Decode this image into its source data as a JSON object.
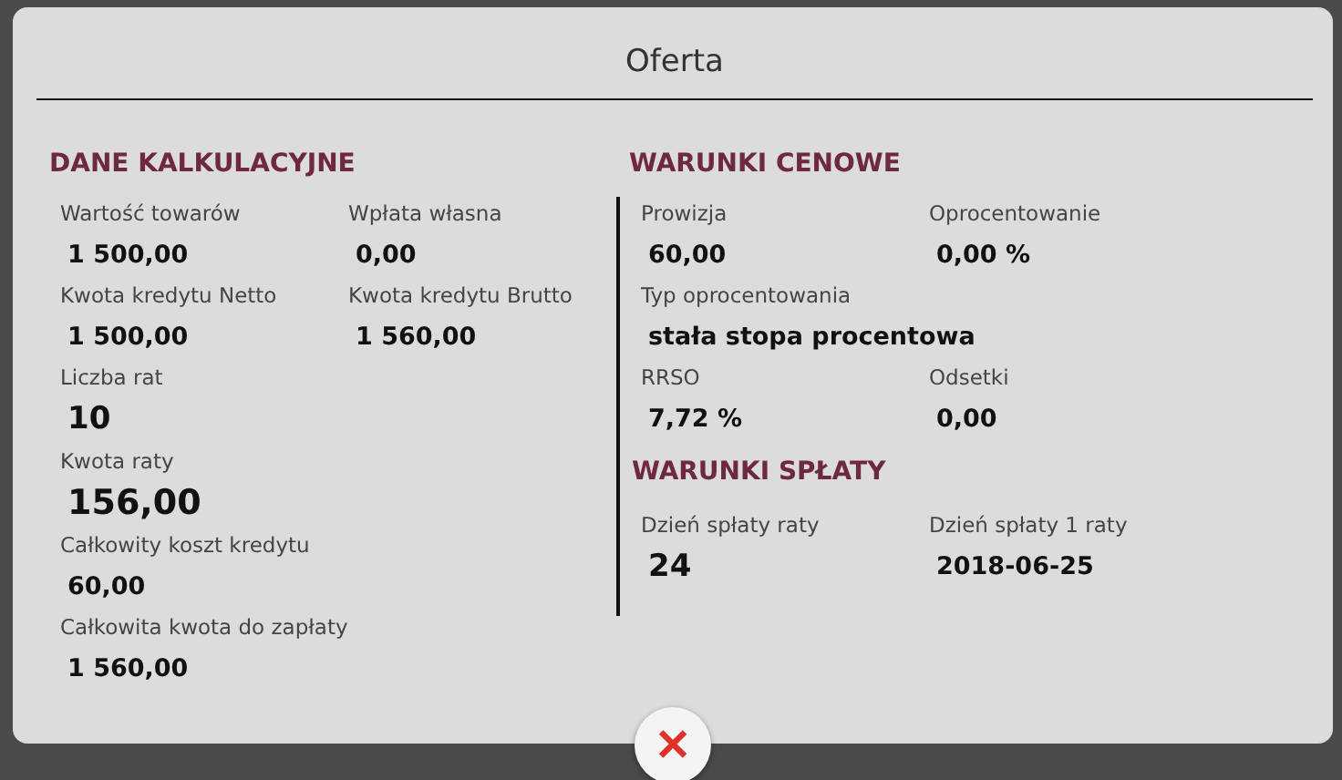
{
  "dialog": {
    "title": "Oferta"
  },
  "sections": [
    {
      "heading": "DANE KALKULACYJNE",
      "divider": false,
      "rows": [
        [
          {
            "label": "Wartość towarów",
            "value": "1 500,00",
            "kind": "normal"
          },
          {
            "label": "Wpłata własna",
            "value": "0,00",
            "kind": "normal"
          }
        ],
        [
          {
            "label": "Kwota kredytu Netto",
            "value": "1 500,00",
            "kind": "normal"
          },
          {
            "label": "Kwota kredytu Brutto",
            "value": "1 560,00",
            "kind": "normal"
          }
        ],
        [
          {
            "label": "Liczba rat",
            "value": "10",
            "kind": "large"
          }
        ],
        [
          {
            "label": "Kwota raty",
            "value": "156,00",
            "kind": "xlarge"
          }
        ],
        [
          {
            "label": "Całkowity koszt kredytu",
            "value": "60,00",
            "kind": "normal"
          }
        ],
        [
          {
            "label": "Całkowita kwota do zapłaty",
            "value": "1 560,00",
            "kind": "normal"
          }
        ]
      ]
    },
    {
      "heading": "WARUNKI CENOWE",
      "divider": true,
      "rows": [
        [
          {
            "label": "Prowizja",
            "value": "60,00",
            "kind": "normal"
          },
          {
            "label": "Oprocentowanie",
            "value": "0,00 %",
            "kind": "normal"
          }
        ],
        [
          {
            "label": "Typ oprocentowania",
            "value": "stała stopa procentowa",
            "kind": "normal"
          }
        ],
        [
          {
            "label": "RRSO",
            "value": "7,72 %",
            "kind": "normal"
          },
          {
            "label": "Odsetki",
            "value": "0,00",
            "kind": "normal"
          }
        ]
      ],
      "subsection": {
        "heading": "WARUNKI SPŁATY",
        "rows": [
          [
            {
              "label": "Dzień spłaty raty",
              "value": "24",
              "kind": "large"
            },
            {
              "label": "Dzień spłaty 1 raty",
              "value": "2018-06-25",
              "kind": "normal"
            }
          ]
        ]
      }
    }
  ],
  "close_button": {
    "symbol": "✕"
  }
}
